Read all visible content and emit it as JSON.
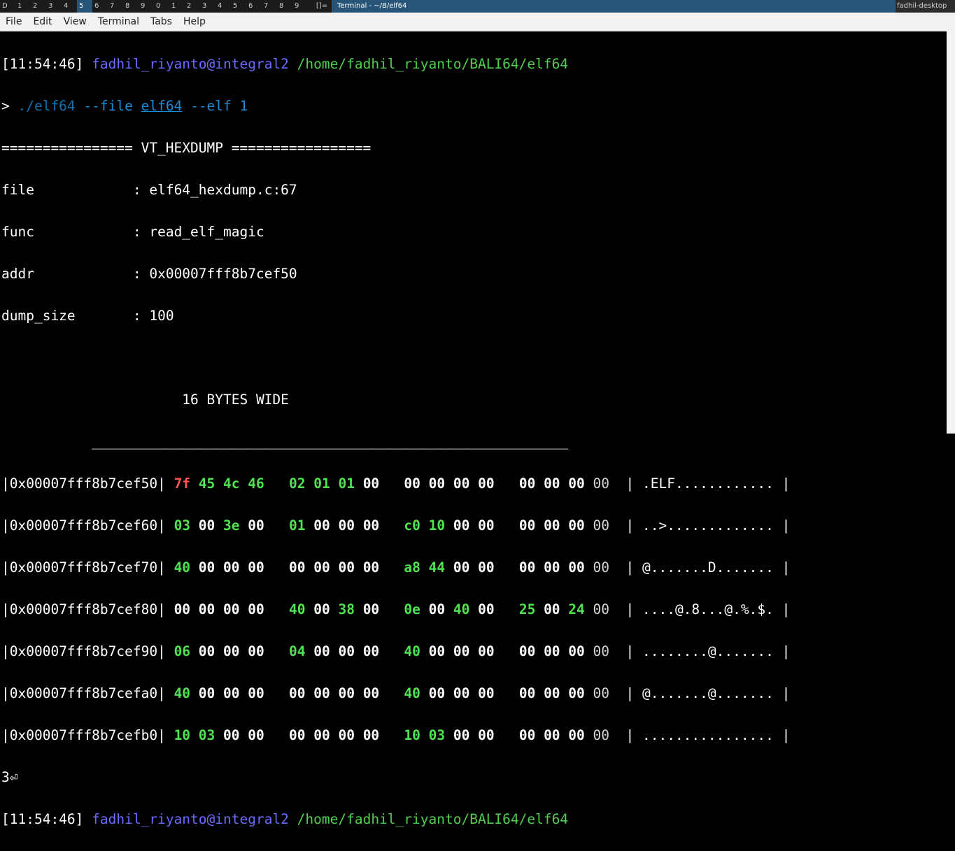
{
  "topbar": {
    "workspaces": [
      "D",
      "1",
      "2",
      "3",
      "4",
      "5",
      "6",
      "7",
      "8",
      "9",
      "0",
      "1",
      "2",
      "3",
      "4",
      "5",
      "6",
      "7",
      "8",
      "9"
    ],
    "active_workspace": "5",
    "layout_indicator": "[]=",
    "window_title": "Terminal - ~/B/elf64",
    "hostname": "fadhil-desktop"
  },
  "menu": {
    "items": [
      "File",
      "Edit",
      "View",
      "Terminal",
      "Tabs",
      "Help"
    ]
  },
  "terminal": {
    "prompt1": {
      "time": "[11:54:46]",
      "user": "fadhil_riyanto@integral2",
      "cwd": "/home/fadhil_riyanto/BALI64/elf64"
    },
    "command": {
      "prefix": "> ",
      "exe": "./elf64",
      "flag1": "--file",
      "arg1": "elf64",
      "flag2": "--elf",
      "arg2": "1"
    },
    "banner": "================ VT_HEXDUMP =================",
    "info": [
      {
        "key": "file",
        "value": "elf64_hexdump.c:67"
      },
      {
        "key": "func",
        "value": "read_elf_magic"
      },
      {
        "key": "addr",
        "value": "0x00007fff8b7cef50"
      },
      {
        "key": "dump_size",
        "value": "100"
      }
    ],
    "wide_label": "16 BYTES WIDE",
    "separator": "__________________________________________________________",
    "rows": [
      {
        "addr": "0x00007fff8b7cef50",
        "ascii": ".ELF............"
      },
      {
        "addr": "0x00007fff8b7cef60",
        "ascii": "..>............."
      },
      {
        "addr": "0x00007fff8b7cef70",
        "ascii": "@.......D......."
      },
      {
        "addr": "0x00007fff8b7cef80",
        "ascii": "....@.8...@.%.$."
      },
      {
        "addr": "0x00007fff8b7cef90",
        "ascii": "........@......."
      },
      {
        "addr": "0x00007fff8b7cefa0",
        "ascii": "@.......@......."
      },
      {
        "addr": "0x00007fff8b7cefb0",
        "ascii": "................"
      }
    ],
    "tail": "3⏎",
    "prompt2": {
      "time": "[11:54:46]",
      "user": "fadhil_riyanto@integral2",
      "cwd": "/home/fadhil_riyanto/BALI64/elf64"
    }
  }
}
